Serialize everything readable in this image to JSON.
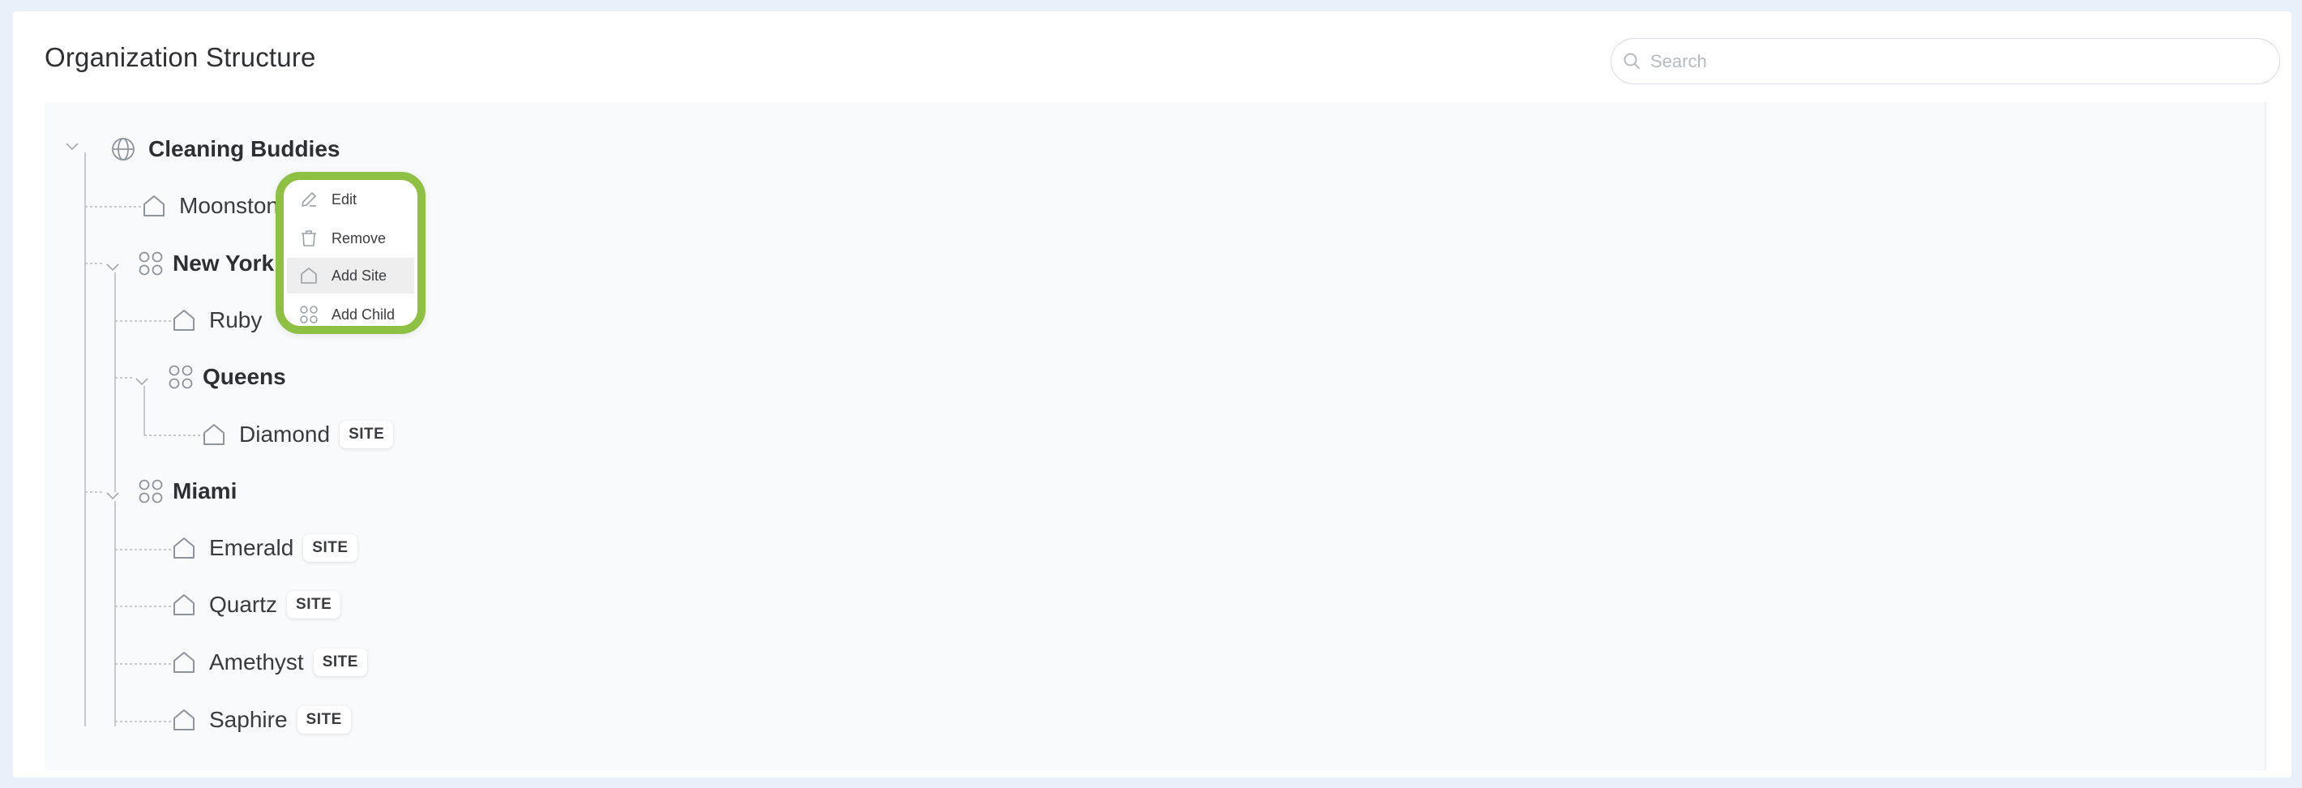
{
  "header": {
    "title": "Organization Structure"
  },
  "search": {
    "placeholder": "Search",
    "value": ""
  },
  "tree": {
    "root": {
      "label": "Cleaning Buddies",
      "icon": "globe-icon"
    },
    "moonstone": {
      "label": "Moonston",
      "icon": "house-icon"
    },
    "new_york": {
      "label": "New York",
      "icon": "group-icon"
    },
    "ruby": {
      "label": "Ruby",
      "icon": "house-icon"
    },
    "queens": {
      "label": "Queens",
      "icon": "group-icon"
    },
    "diamond": {
      "label": "Diamond",
      "badge": "SITE",
      "icon": "house-icon"
    },
    "miami": {
      "label": "Miami",
      "icon": "group-icon"
    },
    "emerald": {
      "label": "Emerald",
      "badge": "SITE",
      "icon": "house-icon"
    },
    "quartz": {
      "label": "Quartz",
      "badge": "SITE",
      "icon": "house-icon"
    },
    "amethyst": {
      "label": "Amethyst",
      "badge": "SITE",
      "icon": "house-icon"
    },
    "saphire": {
      "label": "Saphire",
      "badge": "SITE",
      "icon": "house-icon"
    }
  },
  "context_menu": {
    "highlight_color": "#8dc043",
    "items": [
      {
        "label": "Edit",
        "icon": "pencil-icon"
      },
      {
        "label": "Remove",
        "icon": "trash-icon"
      },
      {
        "label": "Add Site",
        "icon": "house-icon"
      },
      {
        "label": "Add Child",
        "icon": "group-icon"
      }
    ]
  }
}
